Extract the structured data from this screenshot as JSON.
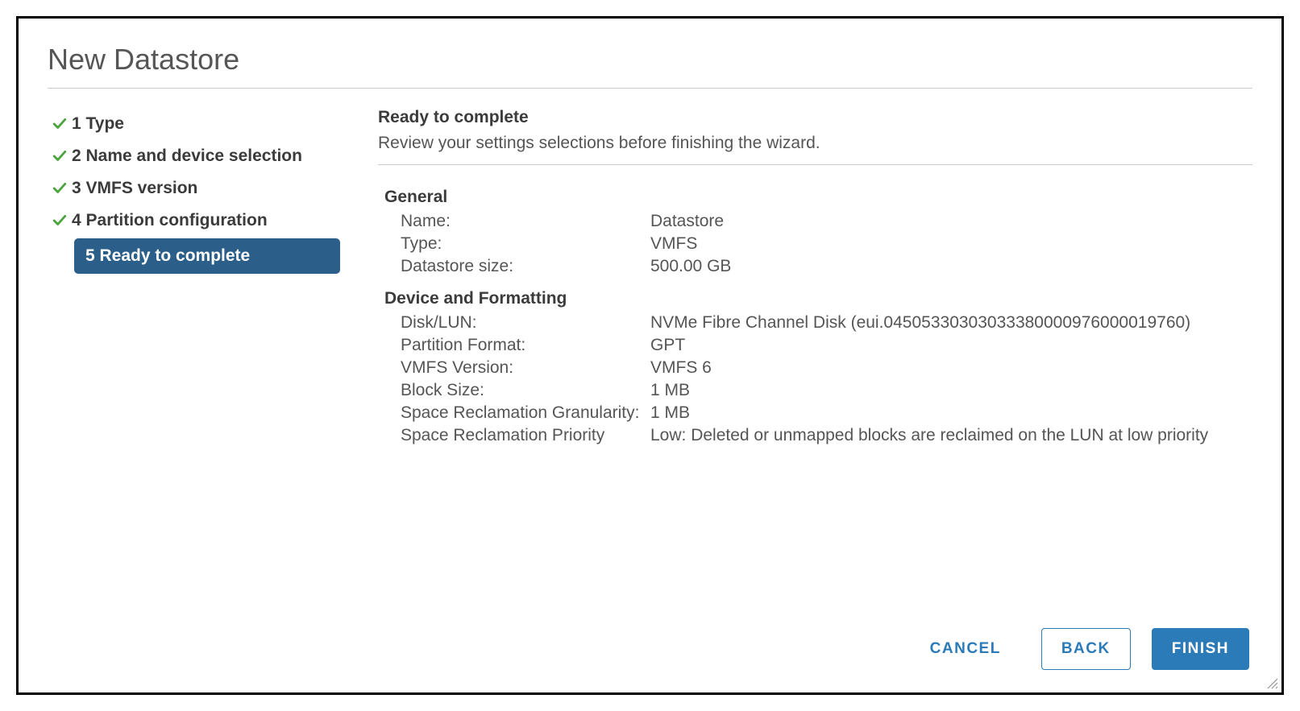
{
  "title": "New Datastore",
  "steps": [
    {
      "label": "1 Type",
      "completed": true,
      "current": false
    },
    {
      "label": "2 Name and device selection",
      "completed": true,
      "current": false
    },
    {
      "label": "3 VMFS version",
      "completed": true,
      "current": false
    },
    {
      "label": "4 Partition configuration",
      "completed": true,
      "current": false
    },
    {
      "label": "5 Ready to complete",
      "completed": false,
      "current": true
    }
  ],
  "main": {
    "heading": "Ready to complete",
    "subheading": "Review your settings selections before finishing the wizard.",
    "sections": {
      "general": {
        "title": "General",
        "name_label": "Name:",
        "name_value": "Datastore",
        "type_label": "Type:",
        "type_value": "VMFS",
        "size_label": "Datastore size:",
        "size_value": "500.00 GB"
      },
      "device": {
        "title": "Device and Formatting",
        "disk_label": "Disk/LUN:",
        "disk_value": "NVMe Fibre Channel Disk (eui.04505330303033380000976000019760)",
        "pformat_label": "Partition Format:",
        "pformat_value": "GPT",
        "vmfs_label": "VMFS Version:",
        "vmfs_value": "VMFS 6",
        "block_label": "Block Size:",
        "block_value": "1 MB",
        "gran_label": "Space Reclamation Granularity:",
        "gran_value": "1 MB",
        "prio_label": "Space Reclamation Priority",
        "prio_value": "Low: Deleted or unmapped blocks are reclaimed on the LUN at low priority"
      }
    }
  },
  "footer": {
    "cancel": "CANCEL",
    "back": "BACK",
    "finish": "FINISH"
  }
}
